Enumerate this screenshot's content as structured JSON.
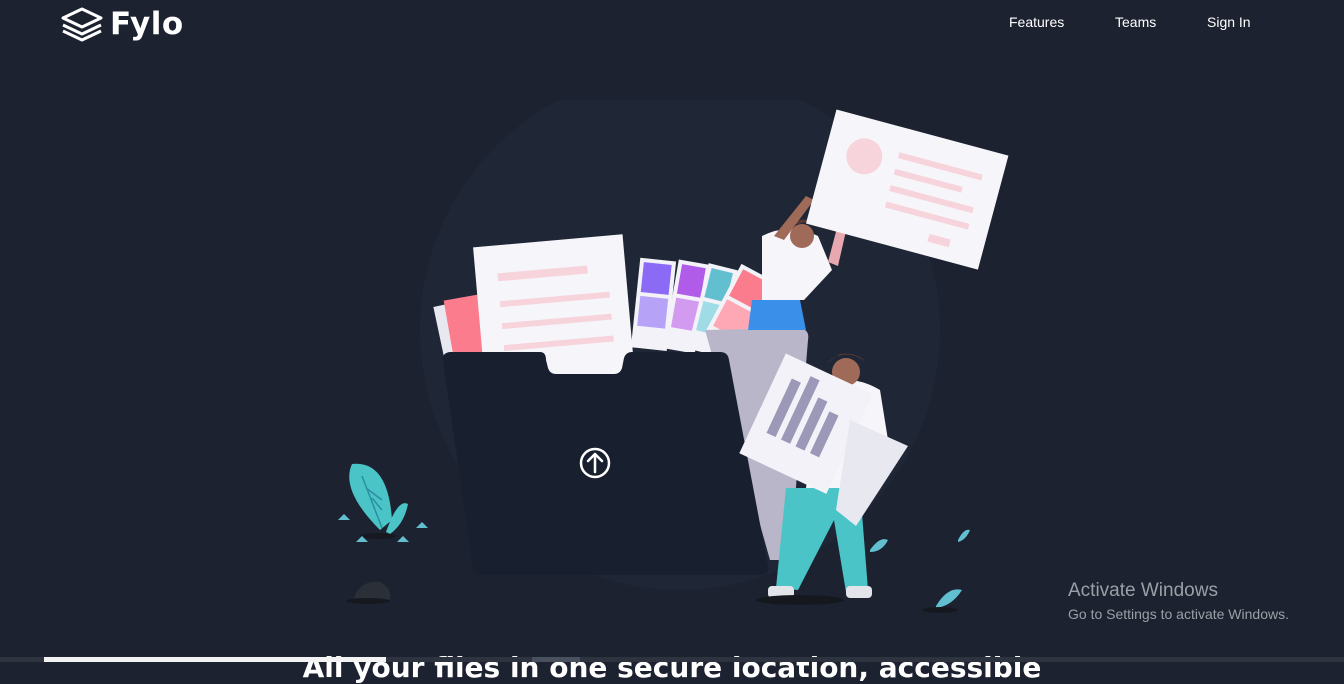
{
  "header": {
    "logo_text": "Fylo",
    "nav": [
      {
        "label": "Features"
      },
      {
        "label": "Teams"
      },
      {
        "label": "Sign In"
      }
    ]
  },
  "hero": {
    "headline": "All your files in one secure location, accessible"
  },
  "windows_watermark": {
    "title": "Activate Windows",
    "subtitle": "Go to Settings to activate Windows."
  },
  "colors": {
    "background": "#1c2230",
    "folder": "#182030",
    "accent_cyan": "#62bfcf",
    "accent_pink": "#fb7c8c",
    "accent_purple": "#8b6bf5"
  }
}
